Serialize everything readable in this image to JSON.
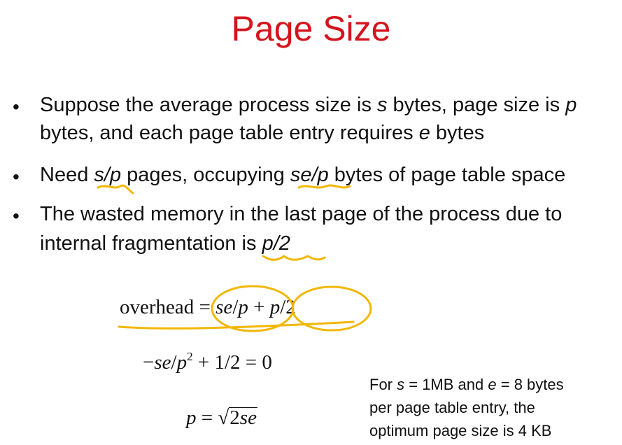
{
  "title": "Page Size",
  "bullets": [
    {
      "line1": {
        "a": "Suppose the average process size is ",
        "s": "s",
        "b": " bytes, page size is ",
        "p": "p"
      },
      "line2": {
        "a": "bytes, and each page table entry requires ",
        "e": "e",
        "b": " bytes"
      }
    },
    {
      "a": "Need ",
      "sp": "s/p",
      "b": " pages, occupying ",
      "sep": "se/p",
      "c": " bytes of page table space"
    },
    {
      "line1": "The wasted memory in the last page of the process due to",
      "line2": {
        "a": "internal fragmentation is ",
        "p2": "p/2"
      }
    }
  ],
  "equations": {
    "eq1": {
      "lhs": "overhead",
      "eq": "=",
      "t1_se": "se",
      "t1_slash": "/",
      "t1_p": "p",
      "plus": "+",
      "t2_p": "p",
      "t2_rest": "/2"
    },
    "eq2": {
      "minus": "−",
      "se": "se",
      "slash": "/",
      "p": "p",
      "exp": "2",
      "rest": " + 1/2 = 0"
    },
    "eq3": {
      "p": "p",
      "eq": " = ",
      "root": "√",
      "two": "2",
      "se": "se"
    }
  },
  "note": {
    "line1": {
      "a": "For ",
      "s": "s",
      "b": " = 1MB and ",
      "e": "e",
      "c": " = 8 bytes"
    },
    "line2": "per page table entry, the",
    "line3": "optimum page size is 4 KB"
  },
  "colors": {
    "title": "#d4141c",
    "annotation": "#f2b705",
    "text": "#111111"
  }
}
